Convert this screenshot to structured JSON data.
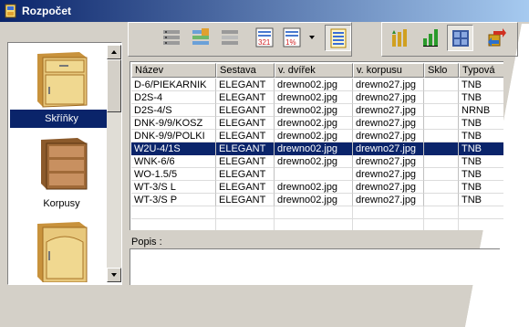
{
  "window": {
    "title": "Rozpočet",
    "colors": {
      "titlebar_start": "#0a246a",
      "titlebar_end": "#a6caf0",
      "face": "#d4d0c8",
      "selection": "#0a246a"
    }
  },
  "categories": [
    {
      "label": "Skříňky",
      "icon": "cabinet-drawer-icon",
      "selected": true
    },
    {
      "label": "Korpusy",
      "icon": "cabinet-carcass-icon",
      "selected": false
    },
    {
      "label": "",
      "icon": "cabinet-door-icon",
      "selected": false
    }
  ],
  "toolbar": {
    "buttons": [
      {
        "icon": "list-edit-icon"
      },
      {
        "icon": "list-color-icon"
      },
      {
        "icon": "list-print-icon"
      },
      {
        "icon": "sort-numeric-icon",
        "text": "321"
      },
      {
        "icon": "percent-icon",
        "text": "1%"
      },
      {
        "icon": "dropdown-arrow-icon"
      },
      {
        "icon": "document-list-icon"
      },
      {
        "icon": "bars-up-icon"
      },
      {
        "icon": "bars-chart-icon"
      },
      {
        "icon": "grid-view-icon"
      },
      {
        "icon": "export-arrows-icon"
      }
    ]
  },
  "table": {
    "columns": [
      "Název",
      "Sestava",
      "v. dvířek",
      "v. korpusu",
      "Sklo",
      "Typová"
    ],
    "rows": [
      [
        "D-6/PIEKARNIK",
        "ELEGANT",
        "drewno02.jpg",
        "drewno27.jpg",
        "",
        "TNB"
      ],
      [
        "D2S-4",
        "ELEGANT",
        "drewno02.jpg",
        "drewno27.jpg",
        "",
        "TNB"
      ],
      [
        "D2S-4/S",
        "ELEGANT",
        "drewno02.jpg",
        "drewno27.jpg",
        "",
        "NRNB"
      ],
      [
        "DNK-9/9/KOSZ",
        "ELEGANT",
        "drewno02.jpg",
        "drewno27.jpg",
        "",
        "TNB"
      ],
      [
        "DNK-9/9/POLKI",
        "ELEGANT",
        "drewno02.jpg",
        "drewno27.jpg",
        "",
        "TNB"
      ],
      [
        "W2U-4/1S",
        "ELEGANT",
        "drewno02.jpg",
        "drewno27.jpg",
        "",
        "TNB"
      ],
      [
        "WNK-6/6",
        "ELEGANT",
        "drewno02.jpg",
        "drewno27.jpg",
        "",
        "TNB"
      ],
      [
        "WO-1.5/5",
        "ELEGANT",
        "",
        "drewno27.jpg",
        "",
        "TNB"
      ],
      [
        "WT-3/S L",
        "ELEGANT",
        "drewno02.jpg",
        "drewno27.jpg",
        "",
        "TNB"
      ],
      [
        "WT-3/S P",
        "ELEGANT",
        "drewno02.jpg",
        "drewno27.jpg",
        "",
        "TNB"
      ]
    ],
    "selected_row": 5
  },
  "popis": {
    "label": "Popis :",
    "value": ""
  }
}
